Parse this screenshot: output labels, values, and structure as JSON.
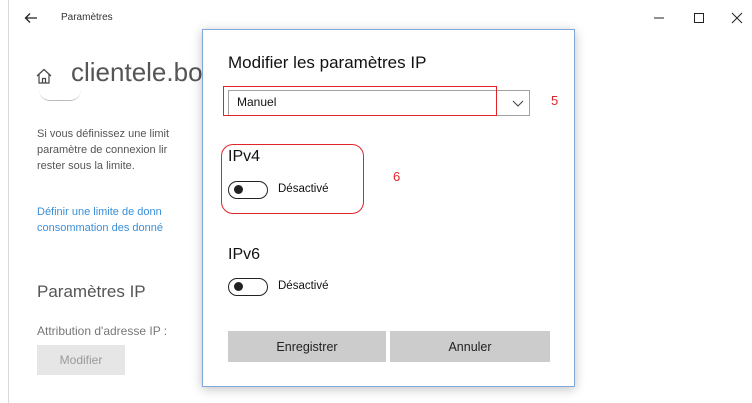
{
  "app": {
    "title": "Paramètres"
  },
  "window_controls": {
    "minimize_icon": "minimize-icon",
    "maximize_icon": "maximize-icon",
    "close_icon": "close-icon"
  },
  "page": {
    "title": "clientele.bo",
    "description_lines": [
      "Si vous définissez une limit",
      "paramètre de connexion lir",
      "rester sous la limite."
    ],
    "link_lines": [
      "Définir une limite de donn",
      "consommation des donné"
    ],
    "section_title": "Paramètres IP",
    "attribution_label": "Attribution d'adresse IP :",
    "modifier_label": "Modifier"
  },
  "dialog": {
    "title": "Modifier les paramètres IP",
    "select_value": "Manuel",
    "marker_5": "5",
    "marker_6": "6",
    "ipv4": {
      "label": "IPv4",
      "state_label": "Désactivé",
      "on": false
    },
    "ipv6": {
      "label": "IPv6",
      "state_label": "Désactivé",
      "on": false
    },
    "save_label": "Enregistrer",
    "cancel_label": "Annuler"
  },
  "colors": {
    "accent_link": "#3a8fd6",
    "annotation_red": "#e0242a",
    "dialog_border": "#7fa7d8"
  }
}
